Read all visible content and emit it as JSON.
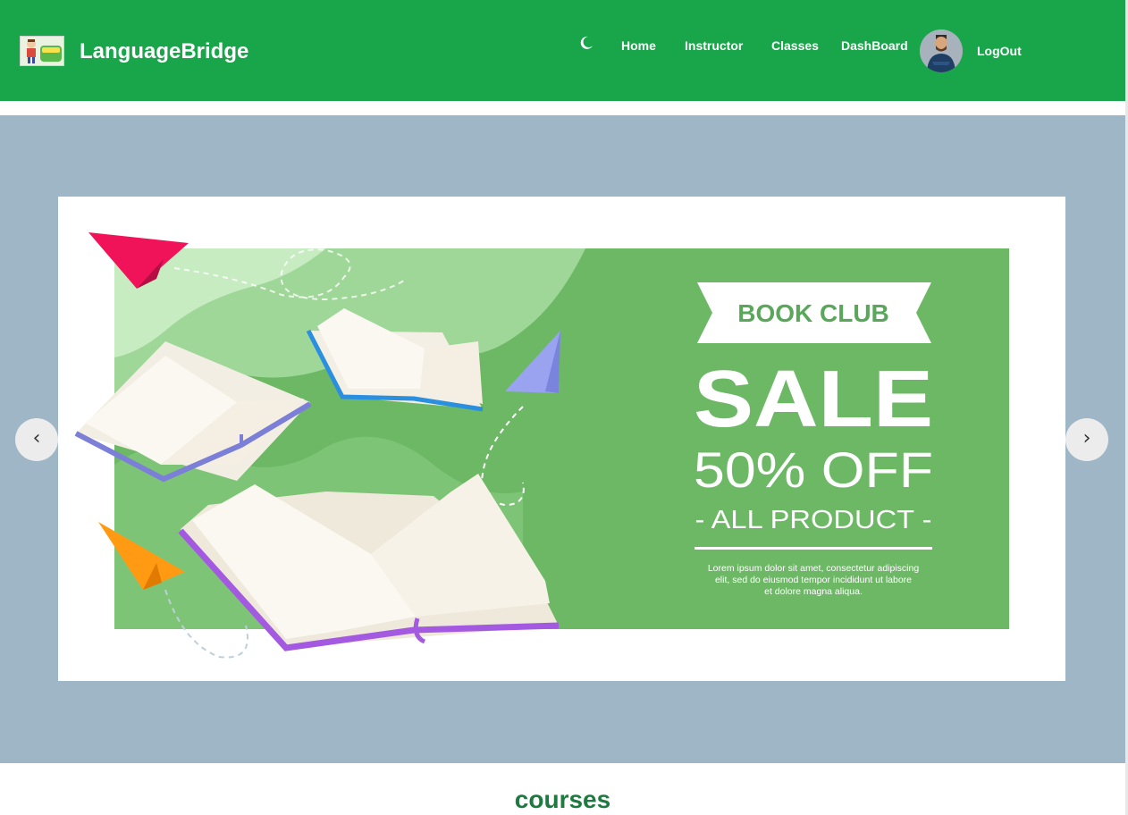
{
  "nav": {
    "brand": "LanguageBridge",
    "links": [
      "Home",
      "Instructor",
      "Classes",
      "DashBoard"
    ],
    "logout": "LogOut",
    "theme_icon": "moon-icon",
    "avatar_icon": "user-avatar"
  },
  "carousel": {
    "prev": "‹",
    "next": "›",
    "slide": {
      "ribbon": "BOOK CLUB",
      "headline": "SALE",
      "discount": "50% OFF",
      "subline": "- ALL PRODUCT -",
      "body": [
        "Lorem ipsum dolor sit amet, consectetur adipiscing",
        "elit, sed do eiusmod tempor incididunt ut labore",
        "et dolore magna aliqua."
      ]
    }
  },
  "section": {
    "title": "courses"
  },
  "colors": {
    "nav_bg": "#19a54a",
    "hero_bg": "#9fb6c7",
    "banner_green": "#6cb865",
    "title_green": "#1e7a40"
  }
}
